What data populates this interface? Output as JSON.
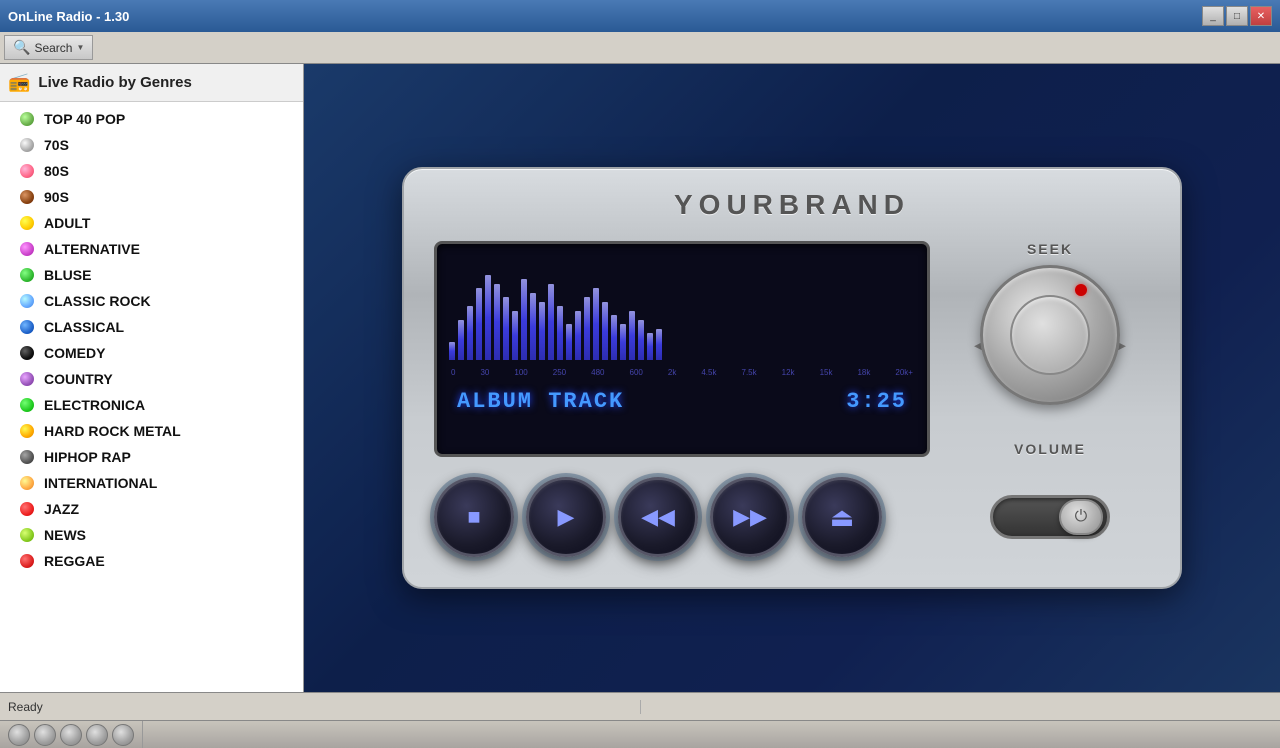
{
  "titleBar": {
    "title": "OnLine Radio - 1.30",
    "controls": [
      "minimize",
      "maximize",
      "close"
    ]
  },
  "toolbar": {
    "searchLabel": "Search",
    "dropdownArrow": "▼"
  },
  "sidebar": {
    "title": "Live Radio by Genres",
    "genres": [
      {
        "name": "TOP 40 POP",
        "color": "#6ab04c"
      },
      {
        "name": "70S",
        "color": "#aaaaaa"
      },
      {
        "name": "80S",
        "color": "#ff6688"
      },
      {
        "name": "90S",
        "color": "#8B4513"
      },
      {
        "name": "ADULT",
        "color": "#ffcc00"
      },
      {
        "name": "ALTERNATIVE",
        "color": "#cc44cc"
      },
      {
        "name": "BLUSE",
        "color": "#33bb33"
      },
      {
        "name": "CLASSIC ROCK",
        "color": "#66aaff"
      },
      {
        "name": "CLASSICAL",
        "color": "#2266cc"
      },
      {
        "name": "COMEDY",
        "color": "#111111"
      },
      {
        "name": "COUNTRY",
        "color": "#9955bb"
      },
      {
        "name": "ELECTRONICA",
        "color": "#22cc22"
      },
      {
        "name": "HARD ROCK METAL",
        "color": "#ffaa00"
      },
      {
        "name": "HIPHOP RAP",
        "color": "#555555"
      },
      {
        "name": "INTERNATIONAL",
        "color": "#ffaa44"
      },
      {
        "name": "JAZZ",
        "color": "#ee2222"
      },
      {
        "name": "NEWS",
        "color": "#88cc22"
      },
      {
        "name": "REGGAE",
        "color": "#dd2222"
      }
    ]
  },
  "player": {
    "brand": "YOURBRAND",
    "seekLabel": "SEEK",
    "volumeLabel": "VOLUME",
    "trackName": "ALBUM TRACK",
    "trackTime": "3:25",
    "eqBars": [
      20,
      45,
      60,
      80,
      95,
      85,
      70,
      55,
      90,
      75,
      65,
      85,
      60,
      40,
      55,
      70,
      80,
      65,
      50,
      40,
      55,
      45,
      30,
      35
    ],
    "eqLabels": [
      "0",
      "30",
      "100",
      "250",
      "480",
      "600",
      "2k",
      "4.5k",
      "7.5k",
      "12k",
      "15k",
      "18k",
      "20k+"
    ],
    "buttons": [
      {
        "name": "stop-button",
        "icon": "■"
      },
      {
        "name": "play-button",
        "icon": "▶"
      },
      {
        "name": "rewind-button",
        "icon": "◀◀"
      },
      {
        "name": "fast-forward-button",
        "icon": "▶▶"
      },
      {
        "name": "eject-button",
        "icon": "⏏"
      }
    ]
  },
  "statusBar": {
    "leftText": "Ready",
    "rightText": ""
  }
}
